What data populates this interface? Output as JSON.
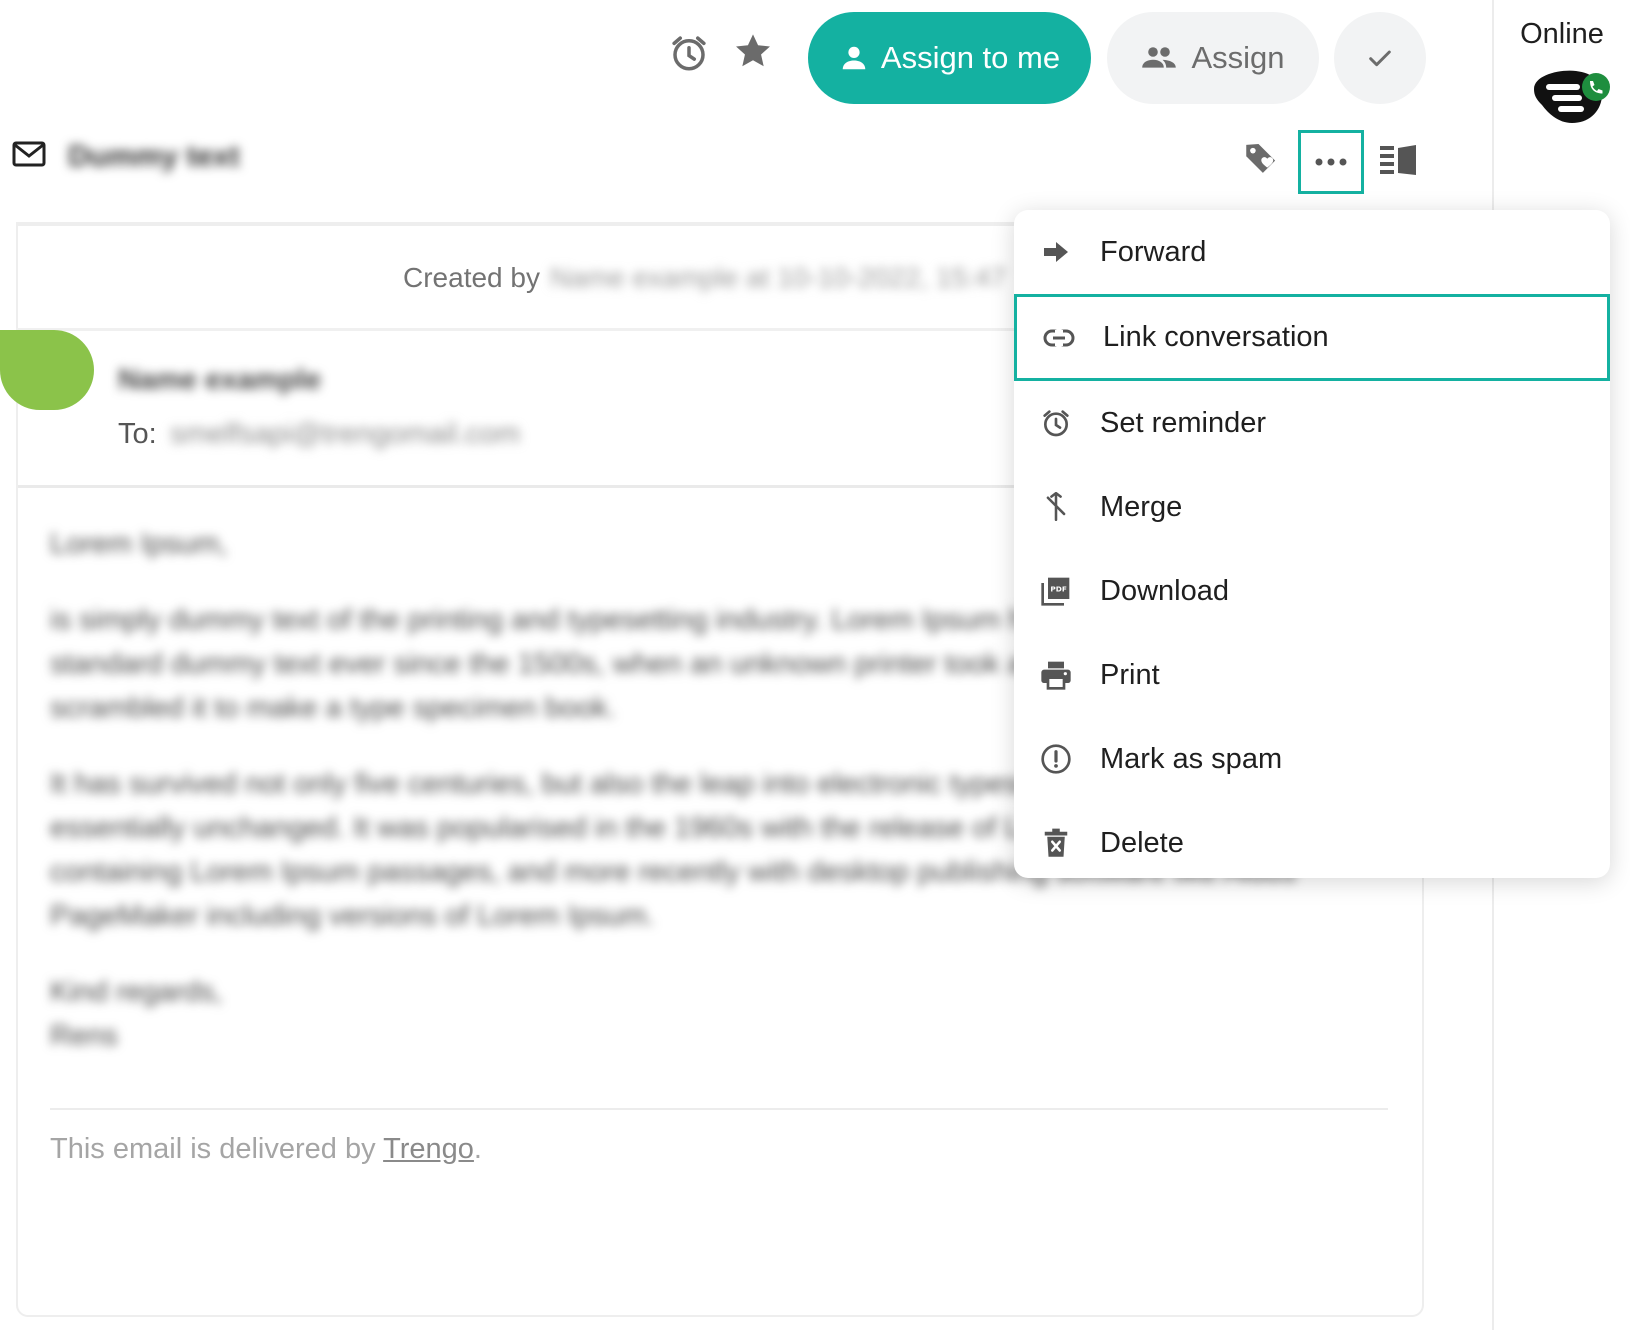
{
  "toolbar": {
    "assign_to_me_label": "Assign to me",
    "assign_label": "Assign",
    "primary_color": "#14b1a1"
  },
  "status": {
    "label": "Online"
  },
  "conversation": {
    "subject": "Dummy text",
    "created_by_prefix": "Created by",
    "created_by_detail": "Name example at 10-10-2022, 15:47",
    "sender_name": "Name example",
    "to_label": "To:",
    "to_value": "smelfsapi@trengomail.com",
    "body": [
      "Lorem Ipsum,",
      "is simply dummy text of the printing and typesetting industry. Lorem Ipsum has been the industry's standard dummy text ever since the 1500s, when an unknown printer took a galley of type and scrambled it to make a type specimen book.",
      "It has survived not only five centuries, but also the leap into electronic typesetting, remaining essentially unchanged. It was popularised in the 1960s with the release of Letraset sheets containing Lorem Ipsum passages, and more recently with desktop publishing software like Aldus PageMaker including versions of Lorem Ipsum.",
      "Kind regards,\nRens"
    ],
    "footer_prefix": "This email is delivered by ",
    "footer_link": "Trengo",
    "footer_suffix": "."
  },
  "menu": {
    "items": [
      {
        "label": "Forward",
        "icon": "forward-icon"
      },
      {
        "label": "Link conversation",
        "icon": "link-icon"
      },
      {
        "label": "Set reminder",
        "icon": "alarm-icon"
      },
      {
        "label": "Merge",
        "icon": "merge-icon"
      },
      {
        "label": "Download",
        "icon": "pdf-icon"
      },
      {
        "label": "Print",
        "icon": "print-icon"
      },
      {
        "label": "Mark as spam",
        "icon": "spam-icon"
      },
      {
        "label": "Delete",
        "icon": "delete-icon"
      }
    ],
    "highlighted_index": 1
  }
}
